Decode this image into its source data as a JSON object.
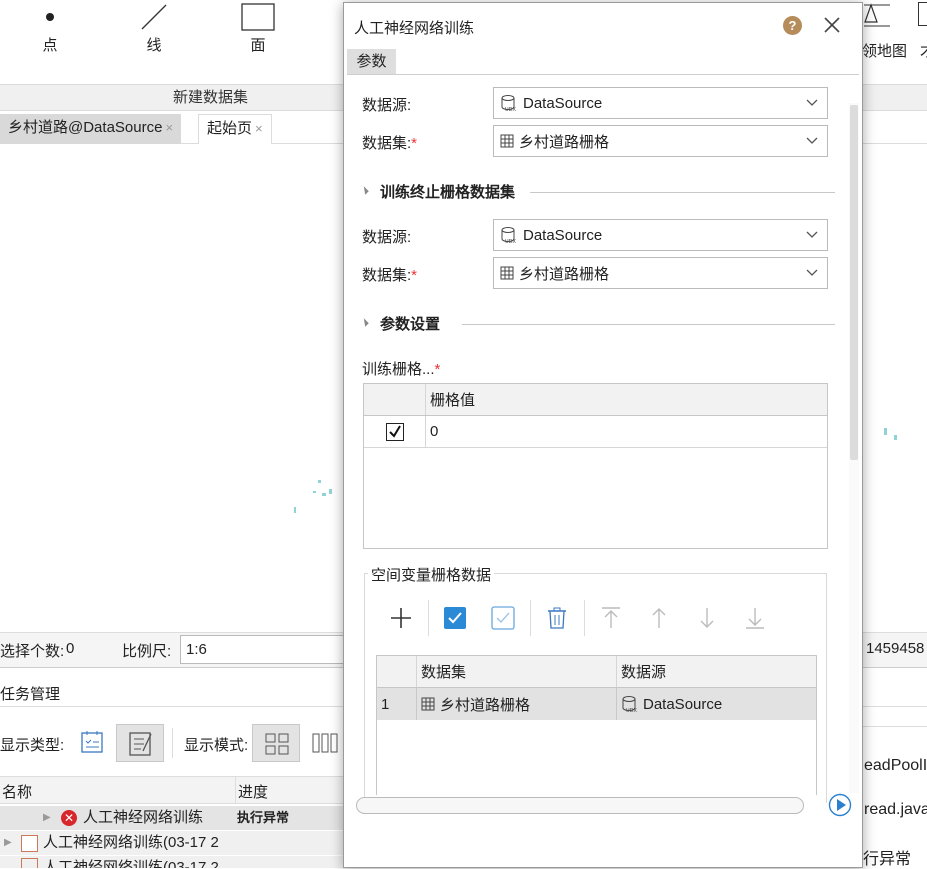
{
  "ribbon": {
    "buttons": [
      {
        "label": "点",
        "icon": "point-icon"
      },
      {
        "label": "线",
        "icon": "line-icon"
      },
      {
        "label": "面",
        "icon": "polygon-icon"
      }
    ],
    "right_label": "领地图",
    "right_partial": "才",
    "group_title": "新建数据集"
  },
  "doc_tabs": [
    {
      "label": "乡村道路@DataSource",
      "close": "×"
    },
    {
      "label": "起始页",
      "close": "×"
    }
  ],
  "status": {
    "selected_label": "选择个数:",
    "selected_value": "0",
    "scale_label": "比例尺:",
    "scale_value": "1:6",
    "coord_partial": "1459458"
  },
  "task_manager": {
    "title": "任务管理",
    "display_type_label": "显示类型:",
    "display_mode_label": "显示模式:",
    "columns": [
      "名称",
      "进度"
    ],
    "rows": [
      {
        "name": "人工神经网络训练",
        "progress": "执行异常"
      },
      {
        "name": "人工神经网络训练(03-17 2",
        "progress": ""
      },
      {
        "name": "人工神经网络训练(03-17 2",
        "progress": ""
      }
    ],
    "log_lines": [
      "eadPoolI",
      "read.java",
      "行异常"
    ]
  },
  "dialog": {
    "title": "人工神经网络训练",
    "help": "?",
    "tab": "参数",
    "source": {
      "datasource_label": "数据源:",
      "datasource_value": "DataSource",
      "dataset_label": "数据集:",
      "dataset_value": "乡村道路栅格"
    },
    "stop_section": {
      "title": "训练终止栅格数据集",
      "datasource_label": "数据源:",
      "datasource_value": "DataSource",
      "dataset_label": "数据集:",
      "dataset_value": "乡村道路栅格"
    },
    "param_section": {
      "title": "参数设置",
      "train_grid_label": "训练栅格...",
      "required_mark": "*",
      "grid_table": {
        "header": "栅格值",
        "rows": [
          {
            "checked": true,
            "value": "0"
          }
        ]
      }
    },
    "spatial_group": {
      "title": "空间变量栅格数据",
      "columns": [
        "数据集",
        "数据源"
      ],
      "rows": [
        {
          "index": "1",
          "dataset": "乡村道路栅格",
          "datasource": "DataSource"
        }
      ]
    }
  },
  "colors": {
    "accent": "#1a73c9",
    "required": "#e33333",
    "help_bg": "#b58c5a"
  }
}
